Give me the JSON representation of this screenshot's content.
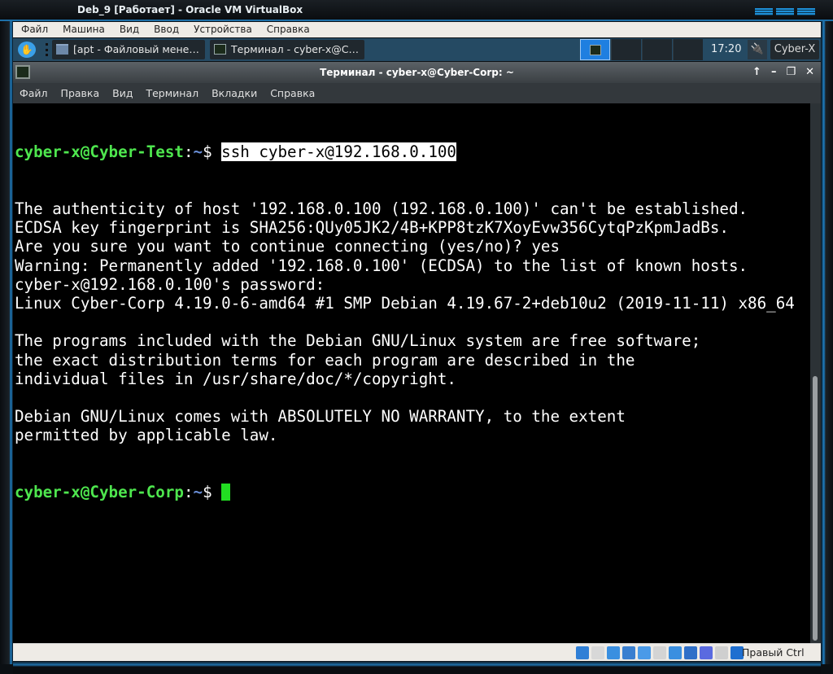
{
  "vbox": {
    "title": "Deb_9 [Работает] - Oracle VM VirtualBox",
    "menu": [
      "Файл",
      "Машина",
      "Вид",
      "Ввод",
      "Устройства",
      "Справка"
    ],
    "status_host_key": "Правый Ctrl",
    "status_icons": [
      "hard-disk-icon",
      "optical-disk-icon",
      "audio-icon",
      "network-icon",
      "usb-icon",
      "shared-folder-icon",
      "display-icon",
      "video-capture-icon",
      "virtualization-icon",
      "mouse-integration-icon",
      "host-key-arrow-icon"
    ]
  },
  "taskbar": {
    "tasks": [
      "[apt - Файловый мене…",
      "Терминал - cyber-x@C…"
    ],
    "clock": "17:20",
    "user": "Cyber-X"
  },
  "terminal": {
    "title": "Терминал - cyber-x@Cyber-Corp: ~",
    "controls": [
      "↑",
      "–",
      "❐",
      "✕"
    ],
    "menu": [
      "Файл",
      "Правка",
      "Вид",
      "Терминал",
      "Вкладки",
      "Справка"
    ],
    "prompt1": {
      "user_host": "cyber-x@Cyber-Test",
      "path": "~",
      "symbol": "$ ",
      "command": "ssh cyber-x@192.168.0.100"
    },
    "output": [
      "The authenticity of host '192.168.0.100 (192.168.0.100)' can't be established.",
      "ECDSA key fingerprint is SHA256:QUy05JK2/4B+KPP8tzK7XoyEvw356CytqPzKpmJadBs.",
      "Are you sure you want to continue connecting (yes/no)? yes",
      "Warning: Permanently added '192.168.0.100' (ECDSA) to the list of known hosts.",
      "cyber-x@192.168.0.100's password:",
      "Linux Cyber-Corp 4.19.0-6-amd64 #1 SMP Debian 4.19.67-2+deb10u2 (2019-11-11) x86_64",
      "",
      "The programs included with the Debian GNU/Linux system are free software;",
      "the exact distribution terms for each program are described in the",
      "individual files in /usr/share/doc/*/copyright.",
      "",
      "Debian GNU/Linux comes with ABSOLUTELY NO WARRANTY, to the extent",
      "permitted by applicable law."
    ],
    "prompt2": {
      "user_host": "cyber-x@Cyber-Corp",
      "path": "~",
      "symbol": "$ "
    }
  }
}
